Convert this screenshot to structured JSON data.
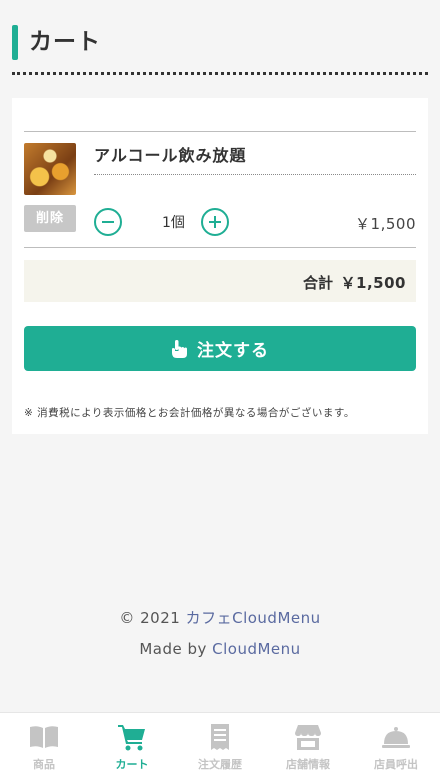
{
  "header": {
    "title": "カート"
  },
  "cart": {
    "item": {
      "name": "アルコール飲み放題",
      "image": "drinks-photo",
      "delete_label": "削除",
      "quantity": "1個",
      "price": "￥1,500"
    },
    "total_label": "合計",
    "total_value": "￥1,500",
    "order_label": "注文する",
    "order_icon": "hand-pointer-icon",
    "notice": "※ 消費税により表示価格とお会計価格が異なる場合がございます。"
  },
  "footer": {
    "copyright_prefix": "© 2021 ",
    "copyright_link": "カフェCloudMenu",
    "made_by_prefix": "Made by ",
    "made_by_link": "CloudMenu"
  },
  "nav": [
    {
      "label": "商品",
      "icon": "book-open-icon",
      "active": false
    },
    {
      "label": "カート",
      "icon": "cart-icon",
      "active": true
    },
    {
      "label": "注文履歴",
      "icon": "receipt-icon",
      "active": false
    },
    {
      "label": "店舗情報",
      "icon": "store-icon",
      "active": false
    },
    {
      "label": "店員呼出",
      "icon": "bell-icon",
      "active": false
    }
  ],
  "colors": {
    "accent": "#1fae94",
    "inactive": "#c4c4c4",
    "link": "#5a6aa0"
  }
}
